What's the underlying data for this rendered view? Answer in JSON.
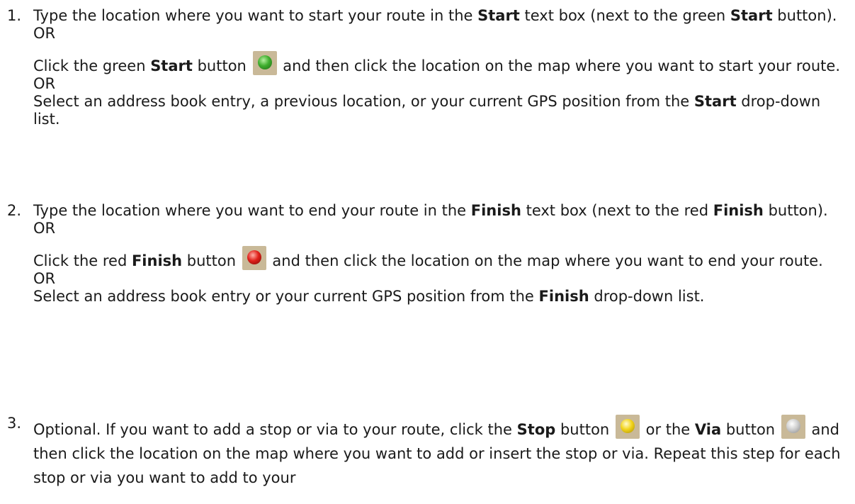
{
  "steps": [
    {
      "number": "1.",
      "line1_a": "Type the location where you want to start your route in the ",
      "line1_b": "Start",
      "line1_c": " text box (next to the green ",
      "line1_d": "Start",
      "line1_e": " button).",
      "or1": "OR",
      "click_a": "Click the green ",
      "click_b": "Start",
      "click_c": " button",
      "click_d": " and then click the location on the map where you want to start your route.",
      "or2": "OR",
      "select_a": "Select an address book entry, a previous location, or your current GPS position from the ",
      "select_b": "Start",
      "select_c": " drop-down list.",
      "icon": "green-start-icon"
    },
    {
      "number": "2.",
      "line1_a": "Type the location where you want to end your route in the ",
      "line1_b": "Finish",
      "line1_c": " text box (next to the red ",
      "line1_d": "Finish",
      "line1_e": " button).",
      "or1": "OR",
      "click_a": "Click the red ",
      "click_b": "Finish",
      "click_c": " button",
      "click_d": " and then click the location on the map where you want to end your route.",
      "or2": "OR",
      "select_a": "Select an address book entry or your current GPS position from the ",
      "select_b": "Finish",
      "select_c": " drop-down list.",
      "icon": "red-finish-icon"
    },
    {
      "number": "3.",
      "opt_a": "Optional.  If you want to add a stop or via to your route, click the ",
      "opt_b": "Stop",
      "opt_c": " button",
      "opt_d": " or the ",
      "opt_e": "Via",
      "opt_f": " button",
      "opt_g": " and then click the location on the map where you want to add or insert the stop or via. Repeat this step for each stop or via you want to add to your",
      "icons": [
        "yellow-stop-icon",
        "grey-via-icon"
      ]
    }
  ]
}
